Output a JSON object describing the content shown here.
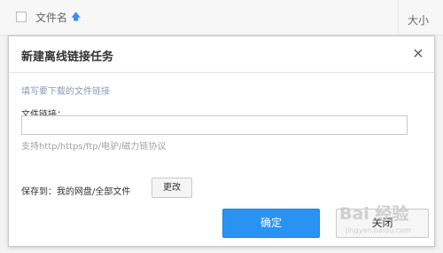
{
  "file_list": {
    "column_name": "文件名",
    "sort_icon": "arrow-up-icon",
    "column_size": "大小"
  },
  "dialog": {
    "title": "新建离线链接任务",
    "close_symbol": "×",
    "hint": "填写要下载的文件链接",
    "link_label": "文件链接：",
    "link_value": "",
    "link_placeholder": "",
    "protocol_note": "支持http/https/ftp/电驴/磁力链协议",
    "save_label": "保存到：",
    "save_path": "我的网盘/全部文件",
    "change_button": "更改",
    "ok_button": "确定",
    "close_button": "关闭"
  },
  "watermark": {
    "text": "Bai 经验",
    "sub": "jingyan.baidu.com"
  },
  "colors": {
    "primary": "#2a93f1",
    "hint": "#8c9bb5"
  }
}
